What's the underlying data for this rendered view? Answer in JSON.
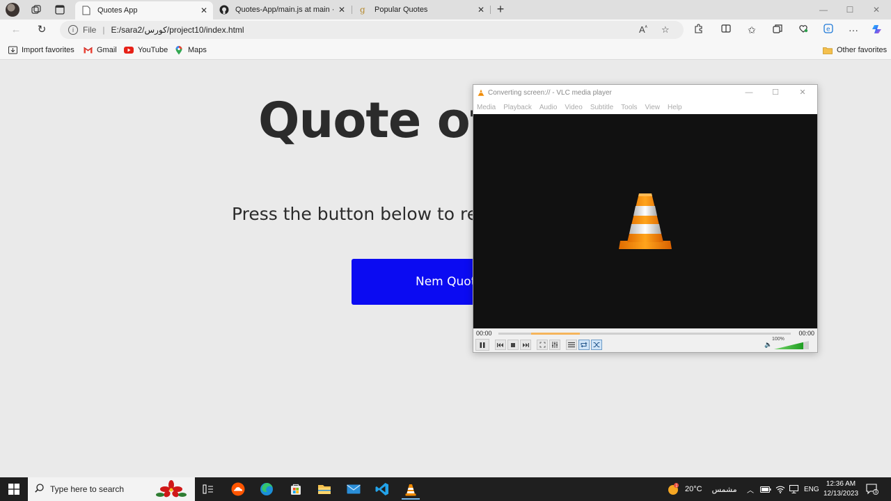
{
  "browser": {
    "tabs": [
      {
        "title": "Quotes App",
        "favicon": "page-icon"
      },
      {
        "title": "Quotes-App/main.js at main · ah",
        "favicon": "github-icon"
      },
      {
        "title": "Popular Quotes",
        "favicon": "g-icon"
      }
    ],
    "close_glyph": "✕",
    "address": {
      "scheme_label": "File",
      "url": "E:/sara2/كورس/project10/index.html"
    },
    "favorites": [
      {
        "label": "Import favorites",
        "icon": "import-icon"
      },
      {
        "label": "Gmail",
        "icon": "gmail-icon"
      },
      {
        "label": "YouTube",
        "icon": "youtube-icon"
      },
      {
        "label": "Maps",
        "icon": "maps-icon"
      }
    ],
    "other_favorites": "Other favorites"
  },
  "page": {
    "heading": "Quote of t",
    "subtitle": "Press the button below to re",
    "button_label": "Nem Quote",
    "button_color": "#0b0bf2"
  },
  "vlc": {
    "title": "Converting screen:// - VLC media player",
    "menu": [
      "Media",
      "Playback",
      "Audio",
      "Video",
      "Subtitle",
      "Tools",
      "View",
      "Help"
    ],
    "time_elapsed": "00:00",
    "time_total": "00:00",
    "volume": "100%",
    "seek_fill_color": "#f5b45b"
  },
  "taskbar": {
    "search_placeholder": "Type here to search",
    "weather_temp": "20°C",
    "weather_label": "مشمس",
    "language": "ENG",
    "time": "12:36 AM",
    "date": "12/13/2023",
    "notification_count": "3"
  }
}
